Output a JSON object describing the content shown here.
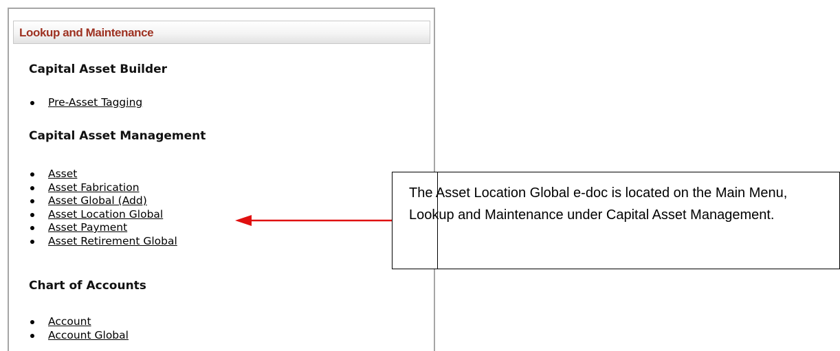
{
  "panel": {
    "title": "Lookup and Maintenance",
    "sections": [
      {
        "title": "Capital Asset Builder",
        "items": [
          {
            "label": "Pre-Asset Tagging"
          }
        ]
      },
      {
        "title": "Capital Asset Management",
        "items": [
          {
            "label": "Asset"
          },
          {
            "label": "Asset Fabrication"
          },
          {
            "label": "Asset Global (Add)"
          },
          {
            "label": "Asset Location Global"
          },
          {
            "label": "Asset Payment"
          },
          {
            "label": "Asset Retirement Global"
          }
        ]
      },
      {
        "title": "Chart of Accounts",
        "items": [
          {
            "label": "Account"
          },
          {
            "label": "Account Global"
          }
        ]
      }
    ]
  },
  "callout": {
    "text": "The Asset Location Global e-doc is located on the Main Menu, Lookup and Maintenance under Capital Asset Management."
  },
  "colors": {
    "header_title": "#9d3121",
    "arrow": "#e01010"
  }
}
